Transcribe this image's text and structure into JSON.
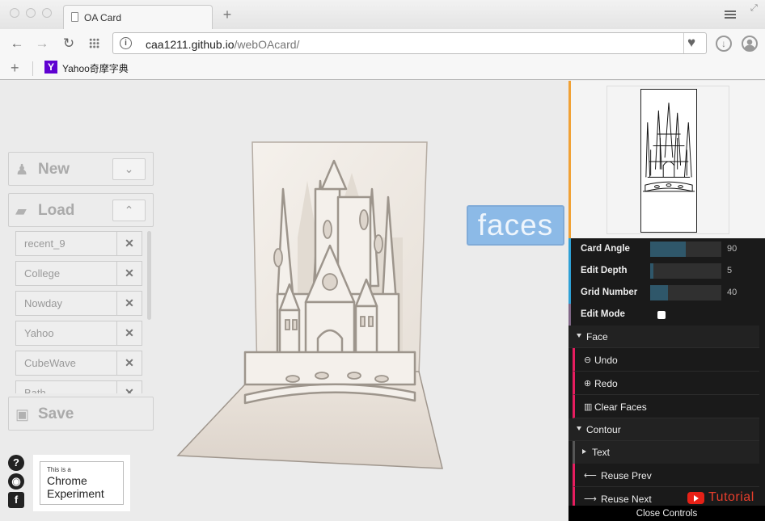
{
  "browser": {
    "tab_title": "OA Card",
    "url_host": "caa1211.github.io",
    "url_path": "/webOAcard/",
    "bookmark_label": "Yahoo奇摩字典"
  },
  "left_panel": {
    "new_label": "New",
    "load_label": "Load",
    "save_label": "Save",
    "saved_items": [
      "recent_9",
      "College",
      "Nowday",
      "Yahoo",
      "CubeWave",
      "Bath"
    ],
    "chrome_experiment_small": "This is a",
    "chrome_experiment_line1": "Chrome",
    "chrome_experiment_line2": "Experiment"
  },
  "overlay_badge": "faces",
  "controls": {
    "card_angle_label": "Card Angle",
    "card_angle_value": 90,
    "card_angle_fraction": 0.5,
    "edit_depth_label": "Edit Depth",
    "edit_depth_value": 5,
    "edit_depth_fraction": 0.05,
    "grid_number_label": "Grid Number",
    "grid_number_value": 40,
    "grid_number_fraction": 0.25,
    "edit_mode_label": "Edit Mode",
    "edit_mode_checked": false,
    "face_folder": "Face",
    "undo": "Undo",
    "redo": "Redo",
    "clear_faces": "Clear Faces",
    "contour_folder": "Contour",
    "text_folder": "Text",
    "reuse_prev": "Reuse Prev",
    "reuse_next": "Reuse Next",
    "close_controls": "Close Controls"
  },
  "tutorial_label": "Tutorial",
  "colors": {
    "accent_blue": "#2fa1d6",
    "accent_pink": "#e61d5f",
    "accent_orange": "#f0a135",
    "tutorial_red": "#e83e2c"
  }
}
